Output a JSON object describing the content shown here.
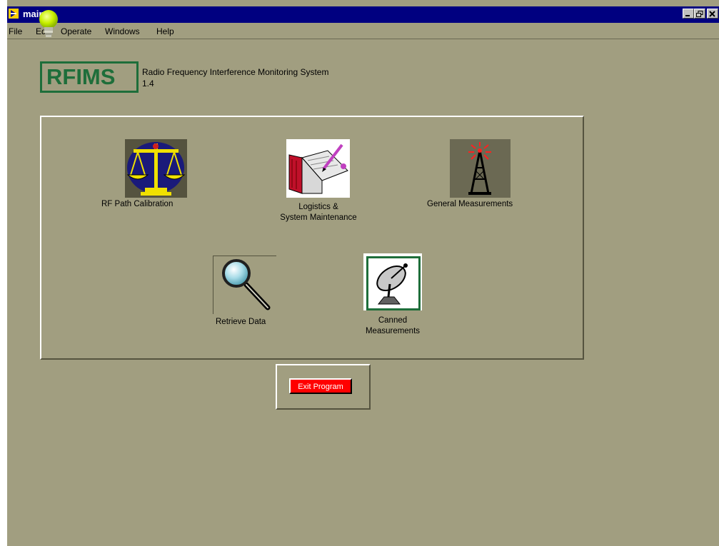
{
  "window": {
    "title": "main",
    "controls": [
      "minimize-icon",
      "restore-icon",
      "close-icon"
    ]
  },
  "menu": {
    "items": [
      {
        "label": "File"
      },
      {
        "label": "Edit"
      },
      {
        "label": "Operate"
      },
      {
        "label": "Windows"
      },
      {
        "label": "Help"
      }
    ]
  },
  "header": {
    "logo_text": "RFIMS",
    "app_title": "Radio Frequency Interference Monitoring System",
    "version": "1.4"
  },
  "tiles": [
    {
      "label": "RF Path Calibration",
      "icon": "scales-icon"
    },
    {
      "label_line1": "Logistics &",
      "label_line2": "System Maintenance",
      "icon": "logbook-icon"
    },
    {
      "label": "General Measurements",
      "icon": "antenna-tower-icon"
    },
    {
      "label": "Retrieve Data",
      "icon": "magnifier-icon"
    },
    {
      "label_line1": "Canned",
      "label_line2": "Measurements",
      "icon": "satellite-dish-icon"
    }
  ],
  "exit": {
    "label": "Exit Program"
  },
  "colors": {
    "background": "#a19e80",
    "titlebar": "#000080",
    "logo": "#1e6e3a",
    "exit_button": "#ff0000"
  }
}
